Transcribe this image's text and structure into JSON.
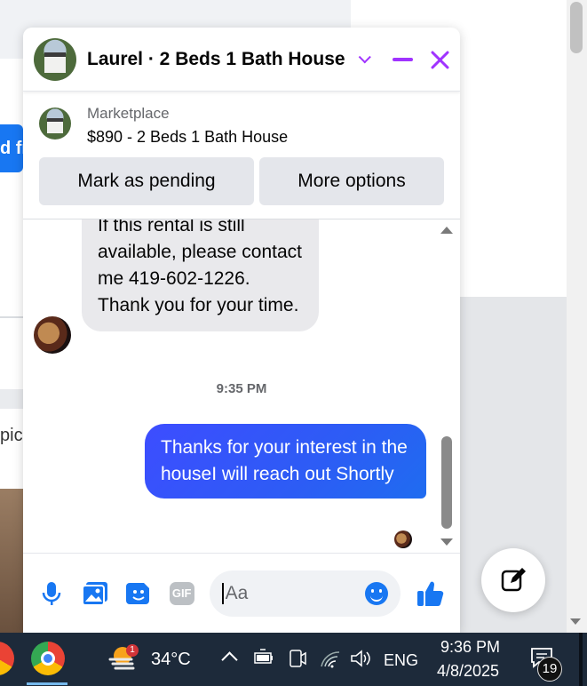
{
  "background": {
    "button_fragment": "d fr",
    "text_fragment": "pic"
  },
  "chat": {
    "title": "Laurel · 2 Beds 1 Bath House",
    "marketplace": {
      "label": "Marketplace",
      "listing": "$890 - 2 Beds 1 Bath House",
      "mark_pending_label": "Mark as pending",
      "more_options_label": "More options"
    },
    "messages": {
      "incoming_text": "If this rental is still available, please contact me 419-602-1226. Thank you for your time.",
      "timestamp": "9:35 PM",
      "outgoing_text": "Thanks for your interest in the houseI will reach out Shortly"
    },
    "composer": {
      "placeholder": "Aa"
    }
  },
  "taskbar": {
    "weather_badge": "1",
    "temperature": "34°C",
    "language": "ENG",
    "time": "9:36 PM",
    "date": "4/8/2025",
    "notification_count": "19"
  },
  "colors": {
    "accent": "#a033ff",
    "messenger_blue": "#1877f2",
    "outgoing_bubble": "#3d4dff",
    "taskbar": "#1d2a3a"
  }
}
